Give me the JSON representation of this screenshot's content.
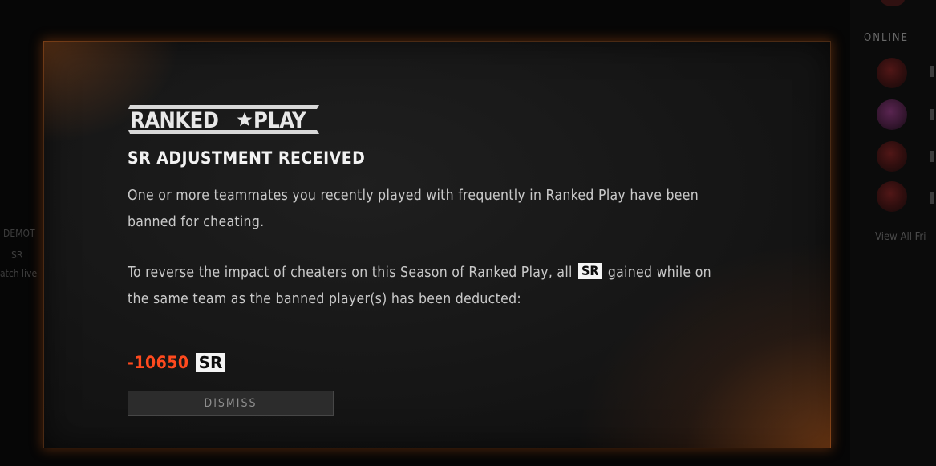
{
  "background": {
    "friends_panel": {
      "status_label": "ONLINE",
      "view_all_label": "View All Fri"
    },
    "left_snippets": [
      "DEMOT",
      "SR",
      "atch live"
    ]
  },
  "modal": {
    "logo_text_left": "RANKED",
    "logo_text_right": "PLAY",
    "heading": "SR ADJUSTMENT RECEIVED",
    "paragraph1": "One or more teammates you recently played with frequently in Ranked Play have been banned for cheating.",
    "paragraph2_before": "To reverse the impact of cheaters on this Season of Ranked Play, all",
    "paragraph2_badge": "SR",
    "paragraph2_after": "gained while on the same team as the banned player(s) has been deducted:",
    "deduction_value": "-10650",
    "deduction_unit": "SR",
    "dismiss_label": "DISMISS"
  },
  "colors": {
    "accent_orange": "#ff4a1e",
    "glow": "#c85a14",
    "modal_bg": "#161616"
  }
}
